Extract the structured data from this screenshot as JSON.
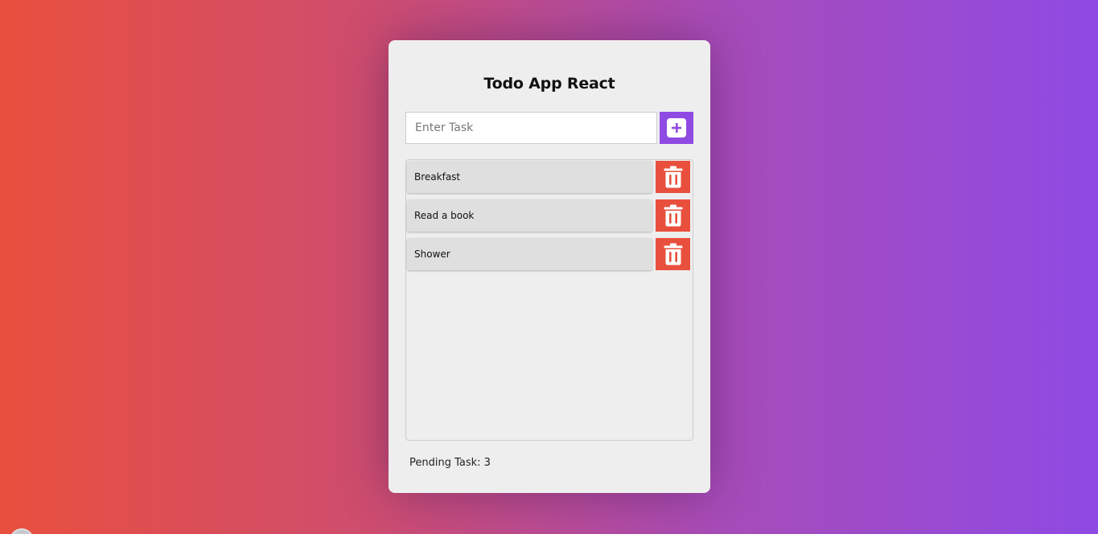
{
  "app": {
    "title": "Todo App React"
  },
  "input": {
    "placeholder": "Enter Task",
    "value": ""
  },
  "add_button": {
    "icon": "plus-square-icon"
  },
  "todos": [
    {
      "label": "Breakfast"
    },
    {
      "label": "Read a book"
    },
    {
      "label": "Shower"
    }
  ],
  "delete_button": {
    "icon": "trash-icon"
  },
  "footer": {
    "pending_label": "Pending Task: 3"
  },
  "colors": {
    "gradient_start": "#e94f3d",
    "gradient_end": "#8f4ae3",
    "accent": "#8f4ae3",
    "danger": "#e94f3d",
    "card": "#eeeeee",
    "item": "#dfdfdf"
  }
}
